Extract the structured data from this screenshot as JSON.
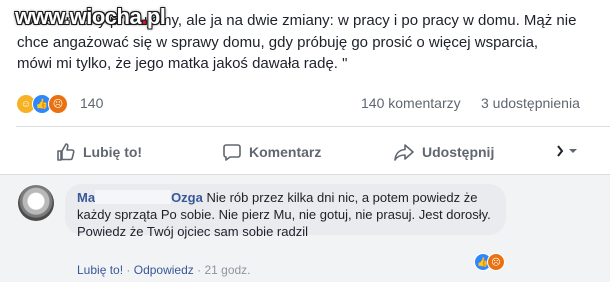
{
  "post": {
    "text": "\"Obie zmiany pracujemy, ale ja na dwie zmiany: w pracy i po pracy w domu. Mąż nie chce angażować się w sprawy domu, gdy próbuję go prosić o więcej wsparcia, mówi mi tylko, że jego matka jakoś dawała radę. \""
  },
  "watermark": {
    "part1": "www.wiocha",
    "dot": ".",
    "part2": "pl"
  },
  "reactions": {
    "icons": [
      "haha-icon",
      "like-icon",
      "angry-icon"
    ],
    "count": "140",
    "comments": "140 komentarzy",
    "shares": "3 udostępnienia"
  },
  "actions": {
    "like": "Lubię to!",
    "comment": "Komentarz",
    "share": "Udostępnij"
  },
  "comment": {
    "author_start": "Ma",
    "author_end": "Ozga",
    "text": "Nie rób przez kilka dni nic, a potem powiedz że każdy sprząta Po sobie. Nie pierz Mu, nie gotuj, nie prasuj. Jest dorosły. Powiedz że Twój ojciec sam sobie radzil",
    "like_label": "Lubię to!",
    "reply_label": "Odpowiedz",
    "separator": "·",
    "time": "21 godz."
  },
  "colors": {
    "link": "#385898",
    "muted": "#606770",
    "accent": "#2d88ff"
  }
}
